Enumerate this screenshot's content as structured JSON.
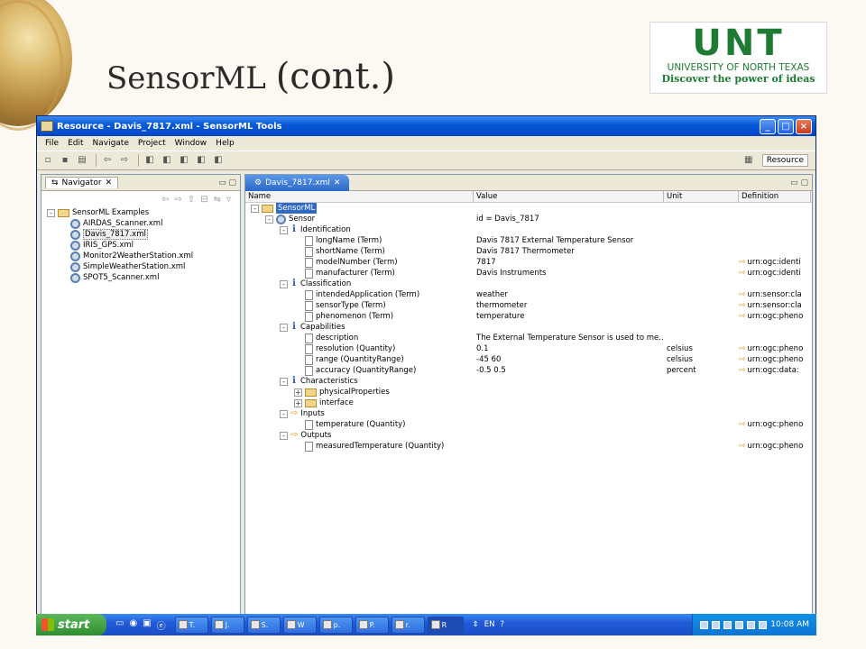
{
  "slide": {
    "title_main": "SensorML",
    "title_suffix": "(cont.)",
    "logo_word": "UNT",
    "logo_line1": "UNIVERSITY OF NORTH TEXAS",
    "logo_line2": "Discover the power of ideas"
  },
  "window": {
    "title": "Resource - Davis_7817.xml - SensorML Tools",
    "menu": [
      "File",
      "Edit",
      "Navigate",
      "Project",
      "Window",
      "Help"
    ],
    "perspective": "Resource"
  },
  "navigator": {
    "tab_label": "Navigator",
    "root": "SensorML Examples",
    "files": [
      "AIRDAS_Scanner.xml",
      "Davis_7817.xml",
      "IRIS_GPS.xml",
      "Monitor2WeatherStation.xml",
      "SimpleWeatherStation.xml",
      "SPOT5_Scanner.xml"
    ],
    "selected_index": 1
  },
  "editor": {
    "tab_label": "Davis_7817.xml",
    "columns": [
      "Name",
      "Value",
      "Unit",
      "Definition"
    ],
    "rows": [
      {
        "name": "SensorML",
        "value": "",
        "unit": "",
        "def": "",
        "indent": 0,
        "icon": "folder",
        "exp": "-"
      },
      {
        "name": "Sensor",
        "value": "id = Davis_7817",
        "unit": "",
        "def": "",
        "indent": 1,
        "icon": "gear",
        "exp": "-"
      },
      {
        "name": "Identification",
        "value": "",
        "unit": "",
        "def": "",
        "indent": 2,
        "icon": "info",
        "exp": "-"
      },
      {
        "name": "longName (Term)",
        "value": "Davis 7817 External Temperature Sensor",
        "unit": "",
        "def": "",
        "indent": 3,
        "icon": "doc",
        "exp": ""
      },
      {
        "name": "shortName (Term)",
        "value": "Davis 7817 Thermometer",
        "unit": "",
        "def": "",
        "indent": 3,
        "icon": "doc",
        "exp": ""
      },
      {
        "name": "modelNumber (Term)",
        "value": "7817",
        "unit": "",
        "def": "urn:ogc:identi",
        "indent": 3,
        "icon": "doc",
        "exp": ""
      },
      {
        "name": "manufacturer (Term)",
        "value": "Davis Instruments",
        "unit": "",
        "def": "urn:ogc:identi",
        "indent": 3,
        "icon": "doc",
        "exp": ""
      },
      {
        "name": "Classification",
        "value": "",
        "unit": "",
        "def": "",
        "indent": 2,
        "icon": "info",
        "exp": "-"
      },
      {
        "name": "intendedApplication (Term)",
        "value": "weather",
        "unit": "",
        "def": "urn:sensor:cla",
        "indent": 3,
        "icon": "doc",
        "exp": ""
      },
      {
        "name": "sensorType (Term)",
        "value": "thermometer",
        "unit": "",
        "def": "urn:sensor:cla",
        "indent": 3,
        "icon": "doc",
        "exp": ""
      },
      {
        "name": "phenomenon (Term)",
        "value": "temperature",
        "unit": "",
        "def": "urn:ogc:pheno",
        "indent": 3,
        "icon": "doc",
        "exp": ""
      },
      {
        "name": "Capabilities",
        "value": "",
        "unit": "",
        "def": "",
        "indent": 2,
        "icon": "info",
        "exp": "-"
      },
      {
        "name": "description",
        "value": "The External Temperature Sensor is used to me...",
        "unit": "",
        "def": "",
        "indent": 3,
        "icon": "doc",
        "exp": ""
      },
      {
        "name": "resolution (Quantity)",
        "value": "0.1",
        "unit": "celsius",
        "def": "urn:ogc:pheno",
        "indent": 3,
        "icon": "doc",
        "exp": ""
      },
      {
        "name": "range (QuantityRange)",
        "value": "-45 60",
        "unit": "celsius",
        "def": "urn:ogc:pheno",
        "indent": 3,
        "icon": "doc",
        "exp": ""
      },
      {
        "name": "accuracy (QuantityRange)",
        "value": "-0.5 0.5",
        "unit": "percent",
        "def": "urn:ogc:data:",
        "indent": 3,
        "icon": "doc",
        "exp": ""
      },
      {
        "name": "Characteristics",
        "value": "",
        "unit": "",
        "def": "",
        "indent": 2,
        "icon": "info",
        "exp": "-"
      },
      {
        "name": "physicalProperties",
        "value": "",
        "unit": "",
        "def": "",
        "indent": 3,
        "icon": "folder",
        "exp": "+"
      },
      {
        "name": "interface",
        "value": "",
        "unit": "",
        "def": "",
        "indent": 3,
        "icon": "folder",
        "exp": "+"
      },
      {
        "name": "Inputs",
        "value": "",
        "unit": "",
        "def": "",
        "indent": 2,
        "icon": "arrow",
        "exp": "-"
      },
      {
        "name": "temperature (Quantity)",
        "value": "",
        "unit": "",
        "def": "urn:ogc:pheno",
        "indent": 3,
        "icon": "doc",
        "exp": ""
      },
      {
        "name": "Outputs",
        "value": "",
        "unit": "",
        "def": "",
        "indent": 2,
        "icon": "arrow",
        "exp": "-"
      },
      {
        "name": "measuredTemperature (Quantity)",
        "value": "",
        "unit": "",
        "def": "urn:ogc:pheno",
        "indent": 3,
        "icon": "doc",
        "exp": ""
      }
    ]
  },
  "taskbar": {
    "start_label": "start",
    "tasks": [
      "T.",
      "J.",
      "S.",
      "W",
      "p.",
      "P.",
      "r.",
      "R"
    ],
    "active_index": 7,
    "lang": "EN",
    "clock": "10:08 AM"
  }
}
